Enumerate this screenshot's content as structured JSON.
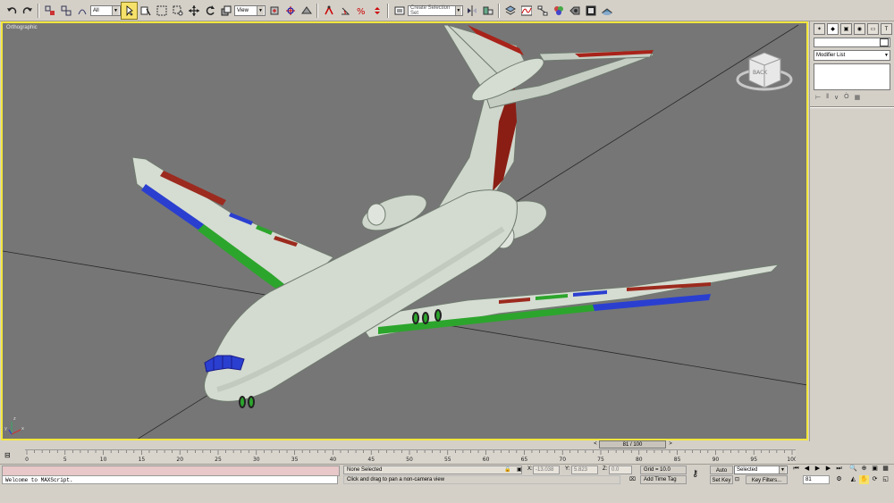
{
  "toolbar": {
    "selection_filter": "All",
    "ref_coord_system": "View",
    "named_selection_set": "Create Selection Set"
  },
  "viewport": {
    "label": "Orthographic",
    "viewcube_label": "BACK"
  },
  "command_panel": {
    "tab_icons": [
      "create-icon",
      "modify-icon",
      "hierarchy-icon",
      "motion-icon",
      "display-icon",
      "utilities-icon"
    ],
    "modifier_list": "Modifier List"
  },
  "timeline": {
    "frame_display": "81 / 100",
    "prev_arrow": "<",
    "next_arrow": ">",
    "ticks": [
      "0",
      "5",
      "10",
      "15",
      "20",
      "25",
      "30",
      "35",
      "40",
      "45",
      "50",
      "55",
      "60",
      "65",
      "70",
      "75",
      "80",
      "85",
      "90",
      "95",
      "100"
    ]
  },
  "status": {
    "maxscript_output": "Welcome to MAXScript.",
    "selection_status": "None Selected",
    "prompt": "Click and drag to pan a non-camera view",
    "x_label": "X:",
    "x_value": "-13.038",
    "y_label": "Y:",
    "y_value": "5.823",
    "z_label": "Z:",
    "z_value": "0.0",
    "grid": "Grid = 10.0",
    "add_time_tag": "Add Time Tag",
    "auto_key": "Auto Key",
    "set_key": "Set Key",
    "key_mode": "Selected",
    "key_filters": "Key Filters...",
    "current_frame": "81"
  }
}
